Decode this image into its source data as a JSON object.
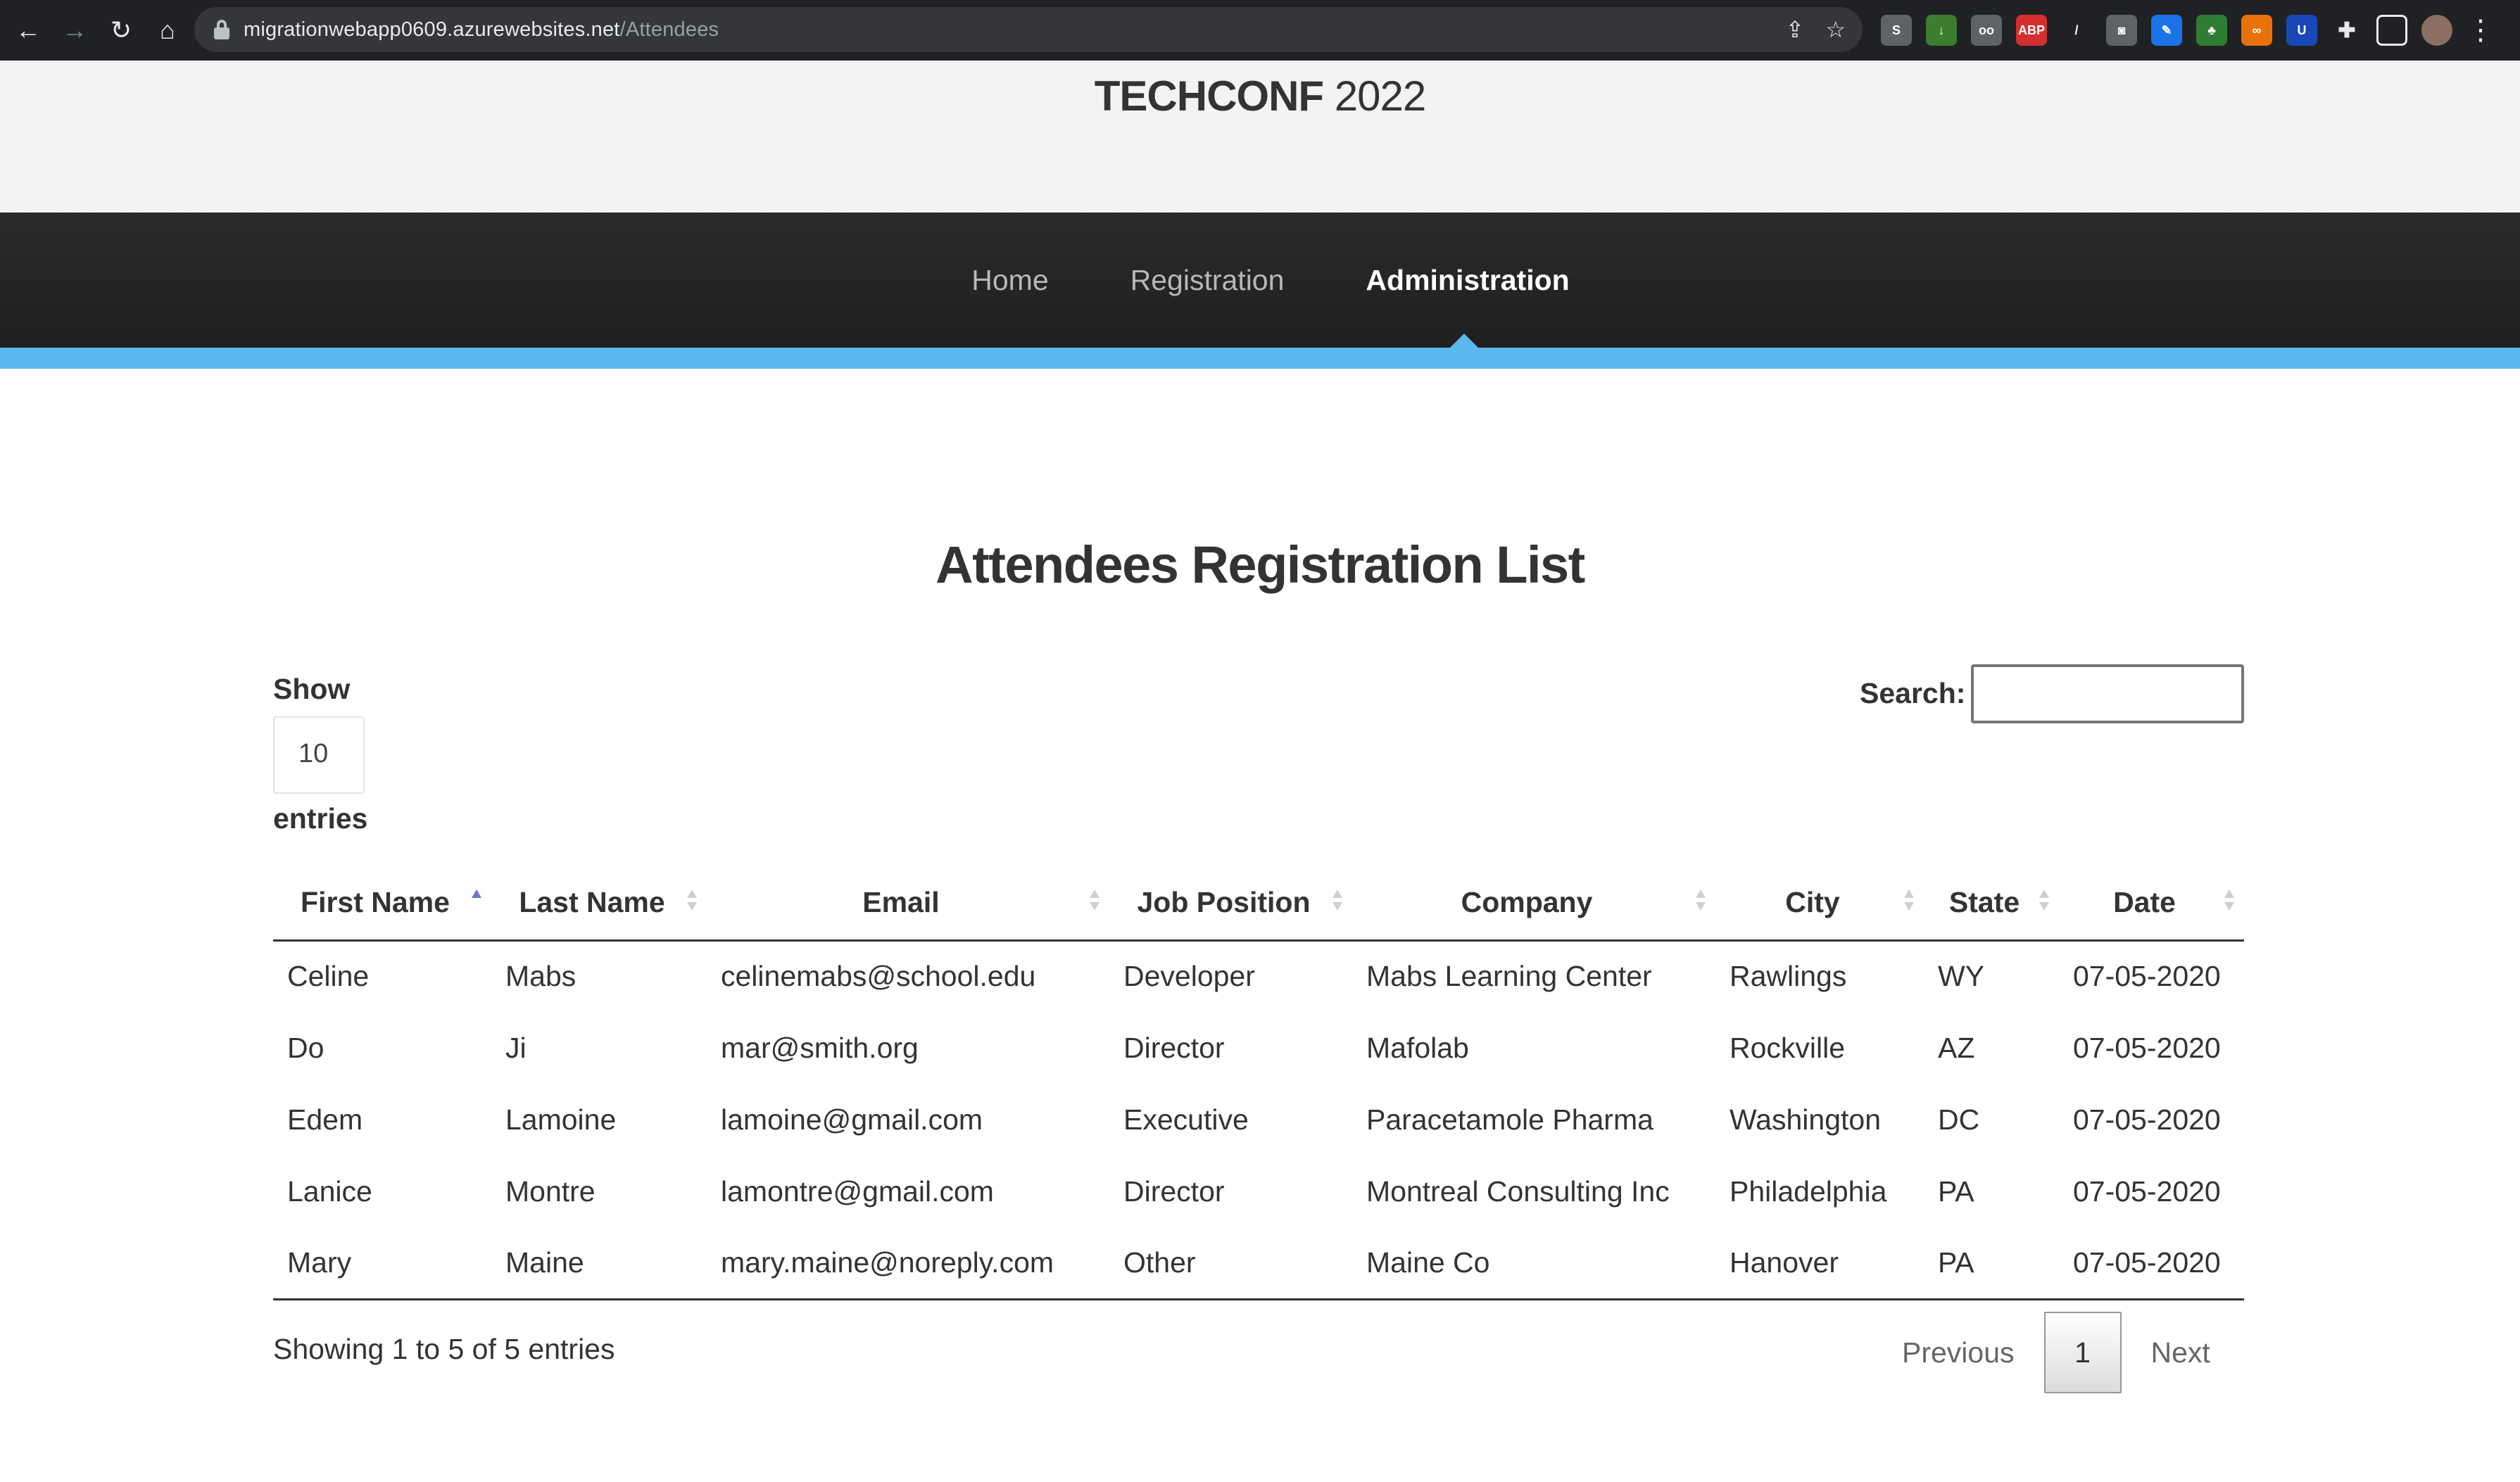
{
  "browser": {
    "url_host": "migrationwebapp0609.azurewebsites.net",
    "url_path": "/Attendees",
    "extensions": [
      {
        "name": "skype-extension-icon",
        "glyph": "S",
        "color": "#5f6368"
      },
      {
        "name": "download-extension-icon",
        "glyph": "↓",
        "color": "#3c7d2f"
      },
      {
        "name": "glasses-extension-icon",
        "glyph": "oo",
        "color": "#5f6368"
      },
      {
        "name": "adblock-plus-icon",
        "glyph": "ABP",
        "color": "#d32f2f"
      },
      {
        "name": "pen-extension-icon",
        "glyph": "/",
        "color": "#202124"
      },
      {
        "name": "camera-extension-icon",
        "glyph": "◙",
        "color": "#5f6368"
      },
      {
        "name": "feather-extension-icon",
        "glyph": "✎",
        "color": "#1a73e8"
      },
      {
        "name": "tree-extension-icon",
        "glyph": "♣",
        "color": "#2e7d32"
      },
      {
        "name": "link-extension-icon",
        "glyph": "∞",
        "color": "#e8710a"
      },
      {
        "name": "shield-extension-icon",
        "glyph": "U",
        "color": "#1a47b8"
      }
    ]
  },
  "site": {
    "title_bold": "TECHCONF",
    "title_year": " 2022",
    "nav": [
      "Home",
      "Registration",
      "Administration"
    ],
    "active_nav": "Administration",
    "accent_color": "#5bb8ec"
  },
  "page": {
    "heading": "Attendees Registration List",
    "show_label": "Show",
    "entries_value": "10",
    "entries_label": "entries",
    "search_label": "Search:",
    "search_value": ""
  },
  "table": {
    "columns": [
      "First Name",
      "Last Name",
      "Email",
      "Job Position",
      "Company",
      "City",
      "State",
      "Date"
    ],
    "sorted_column": "First Name",
    "sort_direction": "ascending",
    "rows": [
      [
        "Celine",
        "Mabs",
        "celinemabs@school.edu",
        "Developer",
        "Mabs Learning Center",
        "Rawlings",
        "WY",
        "07-05-2020"
      ],
      [
        "Do",
        "Ji",
        "mar@smith.org",
        "Director",
        "Mafolab",
        "Rockville",
        "AZ",
        "07-05-2020"
      ],
      [
        "Edem",
        "Lamoine",
        "lamoine@gmail.com",
        "Executive",
        "Paracetamole Pharma",
        "Washington",
        "DC",
        "07-05-2020"
      ],
      [
        "Lanice",
        "Montre",
        "lamontre@gmail.com",
        "Director",
        "Montreal Consulting Inc",
        "Philadelphia",
        "PA",
        "07-05-2020"
      ],
      [
        "Mary",
        "Maine",
        "mary.maine@noreply.com",
        "Other",
        "Maine Co",
        "Hanover",
        "PA",
        "07-05-2020"
      ]
    ]
  },
  "footer": {
    "info": "Showing 1 to 5 of 5 entries",
    "previous": "Previous",
    "current_page": "1",
    "next": "Next"
  }
}
